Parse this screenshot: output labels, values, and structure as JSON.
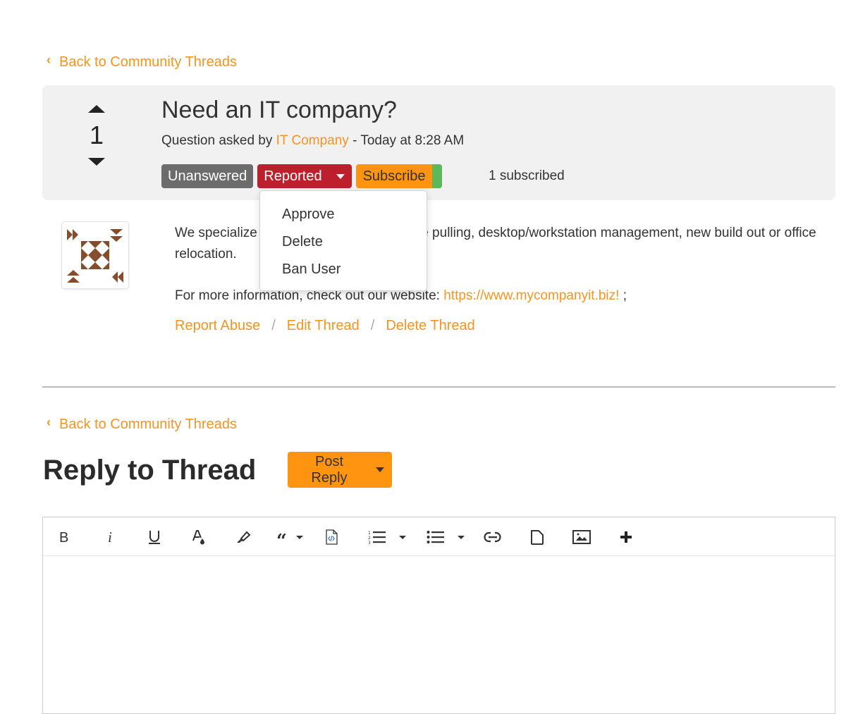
{
  "nav": {
    "back_label": "Back to Community Threads",
    "back_icon": "chevron-left-icon"
  },
  "thread": {
    "vote_count": "1",
    "title": "Need an IT company?",
    "meta_prefix": "Question asked by ",
    "author": "IT Company",
    "meta_suffix": " - Today at 8:28 AM",
    "badges": {
      "unanswered": "Unanswered",
      "reported": "Reported",
      "subscribe": "Subscribe"
    },
    "subscribed_count": "1 subscribed",
    "body_para1_a": "We specialize in network installation, cable pulling, desktop/workstation management, new build out or office relocation.",
    "body_para2_prefix": "For more information, check out our website: ",
    "body_link": "https://www.mycompanyit.biz!",
    "body_para2_suffix": " ;",
    "actions": {
      "report": "Report Abuse",
      "edit": "Edit Thread",
      "delete": "Delete Thread",
      "separator": "/"
    }
  },
  "reported_menu": {
    "items": [
      "Approve",
      "Delete",
      "Ban User"
    ]
  },
  "reply": {
    "title": "Reply to Thread",
    "post_button": "Post Reply"
  },
  "toolbar": {
    "buttons": [
      "bold",
      "italic",
      "underline",
      "font-color",
      "highlight",
      "quote",
      "code-block",
      "ordered-list",
      "unordered-list",
      "link",
      "file",
      "image",
      "more"
    ]
  },
  "colors": {
    "accent": "#f7931e",
    "reported": "#bd1f2d",
    "unanswered": "#6c6c6c",
    "subscribe": "#ff9411",
    "subscribed_toggle": "#5cb85c"
  }
}
